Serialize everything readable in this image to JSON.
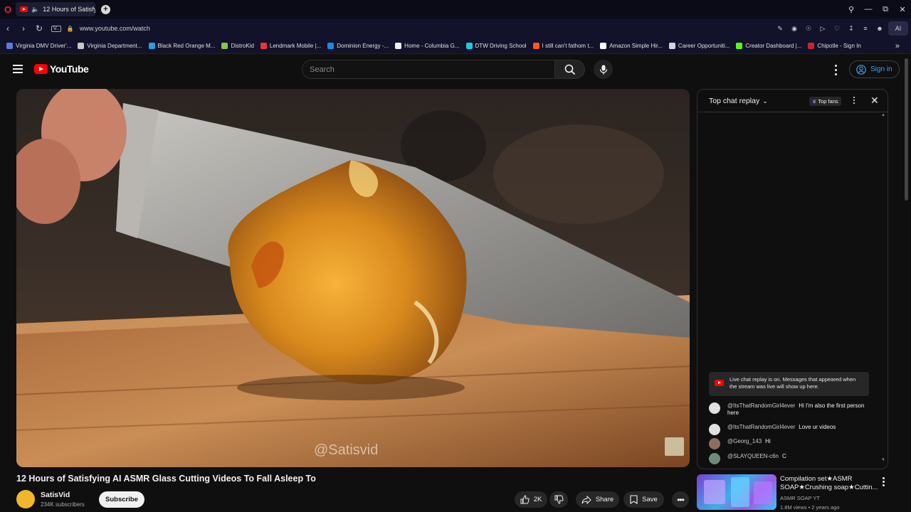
{
  "browser": {
    "tab_title": "12 Hours of Satisfying",
    "url": "www.youtube.com/watch",
    "vpn_label": "V..",
    "ai_label": "AI",
    "bookmarks": [
      {
        "label": "Virginia DMV Driver'...",
        "color": "#5a7bd8"
      },
      {
        "label": "Virginia Department...",
        "color": "#c7c7c7"
      },
      {
        "label": "Black Red Orange M...",
        "color": "#2f9be0"
      },
      {
        "label": "DistroKid",
        "color": "#8bc34a"
      },
      {
        "label": "Lendmark Mobile |...",
        "color": "#e53935"
      },
      {
        "label": "Dominion Energy -...",
        "color": "#1e88e5"
      },
      {
        "label": "Home - Columbia G...",
        "color": "#eeeeee"
      },
      {
        "label": "DTW Driving School",
        "color": "#26c6da"
      },
      {
        "label": "I still can't fathom t...",
        "color": "#ff5722"
      },
      {
        "label": "Amazon Simple Hir...",
        "color": "#ffffff"
      },
      {
        "label": "Career Opportuniti...",
        "color": "#cfd8dc"
      },
      {
        "label": "Creator Dashboard |...",
        "color": "#53fc18"
      },
      {
        "label": "Chipotle - Sign In",
        "color": "#c62828"
      }
    ]
  },
  "youtube": {
    "logo_text": "YouTube",
    "search_placeholder": "Search",
    "signin_label": "Sign in"
  },
  "video": {
    "watermark": "@Satisvid",
    "title": "12 Hours of Satisfying AI ASMR Glass Cutting Videos To Fall Asleep To",
    "channel": "SatisVid",
    "subscribers": "234K subscribers",
    "subscribe_label": "Subscribe",
    "likes": "2K",
    "share_label": "Share",
    "save_label": "Save"
  },
  "chat": {
    "mode_label": "Top chat replay",
    "top_fans_label": "Top fans",
    "replay_notice": "Live chat replay is on. Messages that appeared when the stream was live will show up here.",
    "messages": [
      {
        "author": "@ItsThatRandomGirl4ever",
        "text": "Hi I'm also the first person here",
        "avatar_color": "#e0e0e0"
      },
      {
        "author": "@ItsThatRandomGirl4ever",
        "text": "Love ur videos",
        "avatar_color": "#e0e0e0"
      },
      {
        "author": "@Georg_143",
        "text": "Hi",
        "avatar_color": "#8d6e63"
      },
      {
        "author": "@SLAYQUEEN-c6n",
        "text": "C",
        "avatar_color": "#6d8a7a"
      }
    ]
  },
  "recommendation": {
    "title": "Compilation set★ASMR SOAP★Crushing soap★Cuttin...",
    "channel": "ASMR SOAP YT",
    "meta": "1.8M views • 2 years ago"
  }
}
